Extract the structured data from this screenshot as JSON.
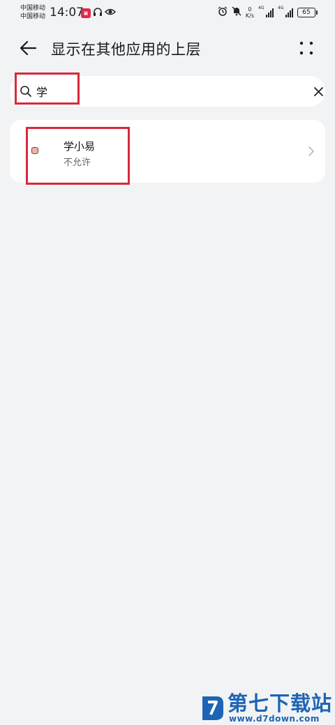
{
  "status_bar": {
    "carrier_1": "中国移动",
    "carrier_2": "中国移动",
    "time": "14:07",
    "speed_value": "0",
    "speed_unit": "K/s",
    "network_1": "4G",
    "network_2": "4G",
    "battery": "65",
    "icons": [
      "notification-app-icon",
      "headphones-icon",
      "eye-icon",
      "alarm-icon",
      "mute-icon",
      "signal-icon",
      "battery-icon"
    ]
  },
  "header": {
    "title": "显示在其他应用的上层"
  },
  "search": {
    "value": "学",
    "placeholder": ""
  },
  "app_list": [
    {
      "name": "学小易",
      "status": "不允许"
    }
  ],
  "watermark": {
    "text": "第七下载站",
    "url": "www.d7down.com"
  },
  "colors": {
    "background": "#f1f3f5",
    "card": "#ffffff",
    "highlight": "#d8283c",
    "watermark": "#1e64b4"
  }
}
